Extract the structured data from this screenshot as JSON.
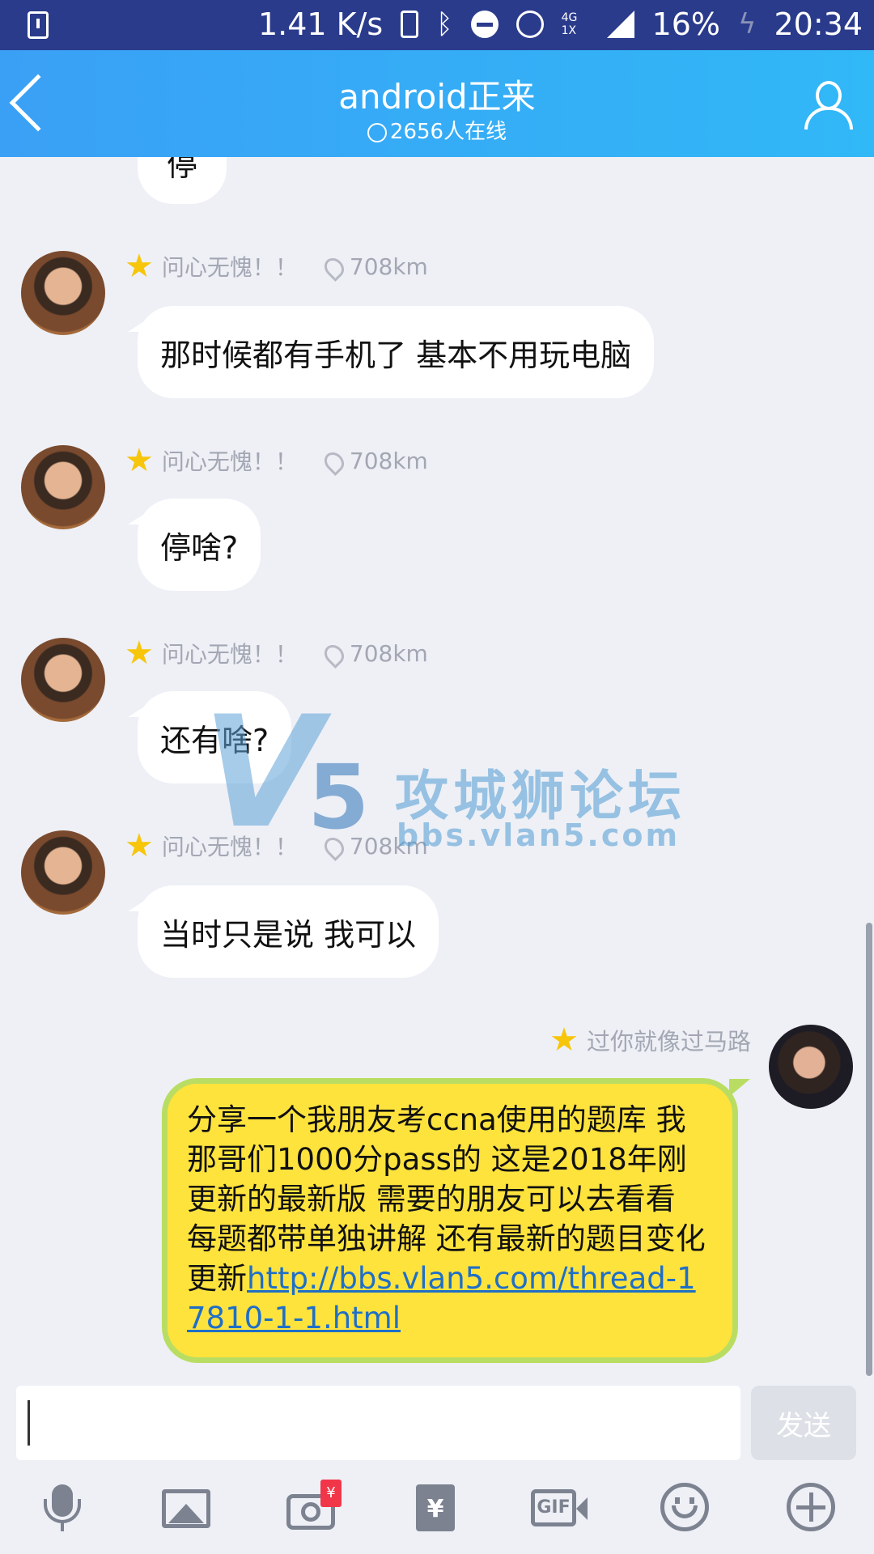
{
  "status_bar": {
    "speed": "1.41 K/s",
    "network": "4G 1X",
    "battery": "16%",
    "time": "20:34"
  },
  "header": {
    "title": "android正来",
    "online": "2656人在线"
  },
  "partial_bubble_text": "停",
  "messages": [
    {
      "name": "问心无愧！！",
      "distance": "708km",
      "text": "那时候都有手机了 基本不用玩电脑"
    },
    {
      "name": "问心无愧！！",
      "distance": "708km",
      "text": "停啥?"
    },
    {
      "name": "问心无愧！！",
      "distance": "708km",
      "text": "还有啥?"
    },
    {
      "name": "问心无愧！！",
      "distance": "708km",
      "text": "当时只是说 我可以"
    }
  ],
  "my_message": {
    "name": "过你就像过马路",
    "text": "分享一个我朋友考ccna使用的题库 我那哥们1000分pass的 这是2018年刚更新的最新版 需要的朋友可以去看看 每题都带单独讲解 还有最新的题目变化更新",
    "link": "http://bbs.vlan5.com/thread-17810-1-1.html"
  },
  "watermark": {
    "logo_v": "V",
    "logo_5": "5",
    "title": "攻城狮论坛",
    "url": "bbs.vlan5.com"
  },
  "input": {
    "value": "",
    "send_label": "发送"
  },
  "toolbar": {
    "icons": [
      "microphone-icon",
      "image-icon",
      "camera-icon",
      "red-envelope-icon",
      "gif-icon",
      "emoji-icon",
      "plus-icon"
    ],
    "camera_badge": "¥",
    "envelope_symbol": "¥",
    "gif_label": "GIF"
  },
  "colors": {
    "header_gradient_start": "#3aa0f5",
    "header_gradient_end": "#31b8f7",
    "status_bar": "#2a3b8c",
    "my_bubble": "#ffe33d",
    "my_bubble_border": "#b9dd62",
    "link": "#1f6fc7"
  }
}
